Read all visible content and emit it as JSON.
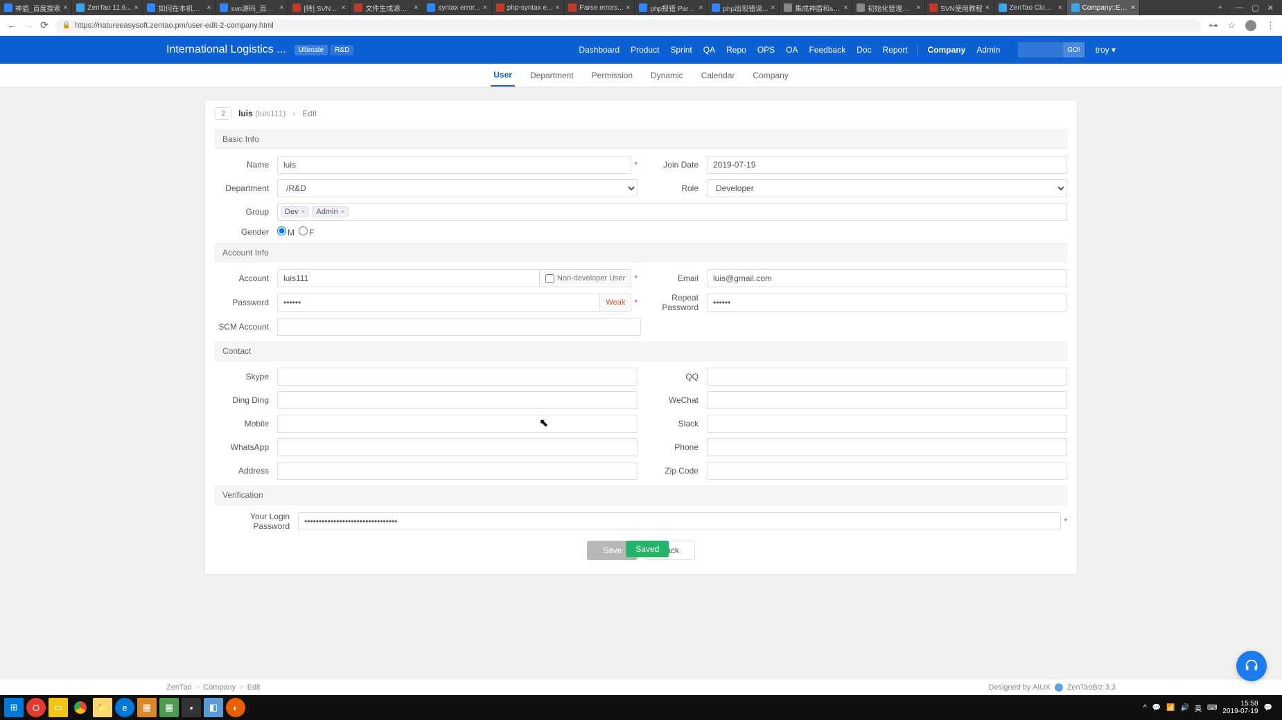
{
  "browser": {
    "tabs": [
      {
        "title": "神盾_百度搜索",
        "favicon": "#3385ff"
      },
      {
        "title": "ZenTao 11.6...",
        "favicon": "#3aa5e8"
      },
      {
        "title": "如何在本机测...",
        "favicon": "#3385ff"
      },
      {
        "title": "svn源码_百度...",
        "favicon": "#3385ff"
      },
      {
        "title": "[转] SVN ...",
        "favicon": "#c0392b"
      },
      {
        "title": "文件生成源代...",
        "favicon": "#c0392b"
      },
      {
        "title": "syntax error...",
        "favicon": "#3385ff"
      },
      {
        "title": "php-syntax e...",
        "favicon": "#c0392b"
      },
      {
        "title": "Parse errors...",
        "favicon": "#c0392b"
      },
      {
        "title": "php报错 Pars...",
        "favicon": "#3385ff"
      },
      {
        "title": "php出现错误...",
        "favicon": "#3385ff"
      },
      {
        "title": "集成神盾和sv...",
        "favicon": "#888"
      },
      {
        "title": "初始化管理密...",
        "favicon": "#888"
      },
      {
        "title": "SVN使用教程",
        "favicon": "#c0392b"
      },
      {
        "title": "ZenTao Cloud ...",
        "favicon": "#3aa5e8"
      },
      {
        "title": "Company::Edit...",
        "favicon": "#3aa5e8",
        "active": true
      }
    ],
    "url": "https://natureeasysoft.zentao.pm/user-edit-2-company.html"
  },
  "topnav": {
    "project": "International Logistics ...",
    "badge_ultimate": "Ultimate",
    "badge_rd": "R&D",
    "items": [
      "Dashboard",
      "Product",
      "Sprint",
      "QA",
      "Repo",
      "OPS",
      "OA",
      "Feedback",
      "Doc",
      "Report"
    ],
    "items_right": [
      "Company",
      "Admin"
    ],
    "active": "Company",
    "go": "GO!",
    "user": "troy"
  },
  "subnav": {
    "items": [
      "User",
      "Department",
      "Permission",
      "Dynamic",
      "Calendar",
      "Company"
    ],
    "active": "User"
  },
  "breadcrumb": {
    "id": "2",
    "name": "luis",
    "sub": "(luis111)",
    "current": "Edit"
  },
  "sections": {
    "basic": "Basic Info",
    "account": "Account Info",
    "contact": "Contact",
    "verification": "Verification"
  },
  "labels": {
    "name": "Name",
    "join_date": "Join Date",
    "department": "Department",
    "role": "Role",
    "group": "Group",
    "gender": "Gender",
    "gender_m": "M",
    "gender_f": "F",
    "account": "Account",
    "nondev": "Non-developer User",
    "email": "Email",
    "password": "Password",
    "weak": "Weak",
    "repeat_password": "Repeat Password",
    "scm": "SCM Account",
    "skype": "Skype",
    "qq": "QQ",
    "dingding": "Ding Ding",
    "wechat": "WeChat",
    "mobile": "Mobile",
    "slack": "Slack",
    "whatsapp": "WhatsApp",
    "phone": "Phone",
    "address": "Address",
    "zip": "Zip Code",
    "login_pw": "Your Login Password"
  },
  "values": {
    "name": "luis",
    "join_date": "2019-07-19",
    "department": "/R&D",
    "role": "Developer",
    "group_tags": [
      "Dev",
      "Admin"
    ],
    "account": "luis111",
    "email": "luis@gmail.com",
    "password": "••••••",
    "repeat_password": "••••••",
    "login_pw": "••••••••••••••••••••••••••••••••"
  },
  "buttons": {
    "save": "Save",
    "back": "Back",
    "saved": "Saved"
  },
  "footer": {
    "path": [
      "ZenTao",
      "Company",
      "Edit"
    ],
    "designed": "Designed by AIUX",
    "version": "ZenTaoBiz 3.3"
  },
  "systray": {
    "time": "15:58",
    "date": "2019-07-19"
  }
}
